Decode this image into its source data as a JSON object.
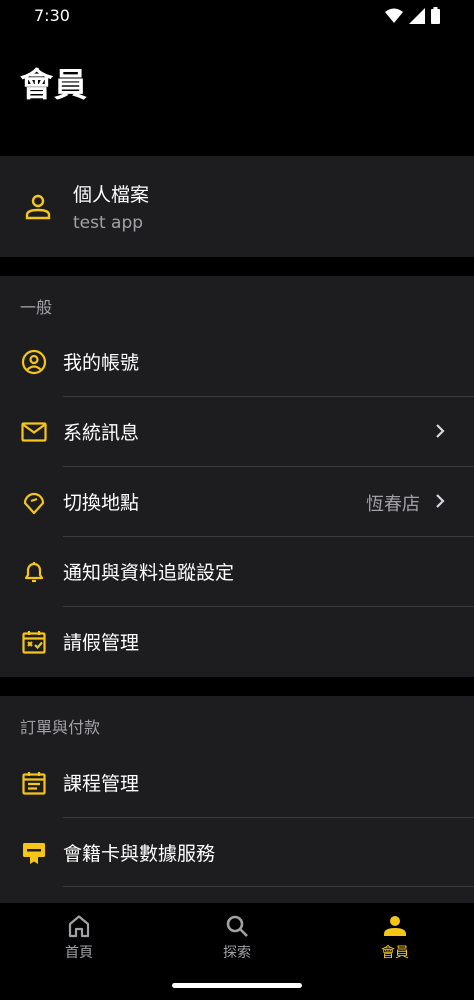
{
  "status_bar": {
    "time": "7:30",
    "icons": [
      "wifi-icon",
      "signal-icon",
      "battery-icon"
    ]
  },
  "page": {
    "title": "會員"
  },
  "colors": {
    "accent": "#f5c518",
    "background": "#000000",
    "card": "#1d1d1f",
    "secondary_text": "#a2a2a6",
    "divider": "#3a3a3c"
  },
  "profile": {
    "icon": "person-icon",
    "name": "個人檔案",
    "subtitle": "test app"
  },
  "general": {
    "header": "一般",
    "items": [
      {
        "label": "我的帳號",
        "icon": "account-circle-icon"
      },
      {
        "label": "系統訊息",
        "icon": "mail-icon",
        "chevron": true
      },
      {
        "label": "切換地點",
        "icon": "location-pin-icon",
        "value": "恆春店",
        "chevron": true
      },
      {
        "label": "通知與資料追蹤設定",
        "icon": "bell-icon"
      },
      {
        "label": "請假管理",
        "icon": "calendar-leave-icon"
      }
    ]
  },
  "orders": {
    "header": "訂單與付款",
    "items": [
      {
        "label": "課程管理",
        "icon": "calendar-list-icon"
      },
      {
        "label": "會籍卡與數據服務",
        "icon": "membership-card-icon"
      }
    ]
  },
  "bottom_nav": {
    "items": [
      {
        "label": "首頁",
        "icon": "home-icon",
        "active": false
      },
      {
        "label": "探索",
        "icon": "search-icon",
        "active": false
      },
      {
        "label": "會員",
        "icon": "member-icon",
        "active": true
      }
    ]
  }
}
